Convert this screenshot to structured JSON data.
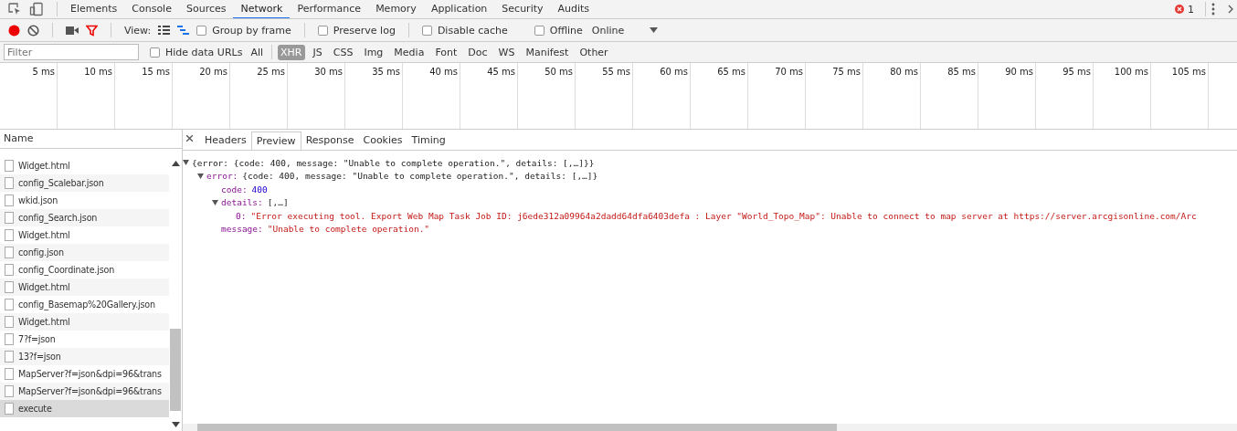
{
  "panel_tabs": [
    {
      "label": "Elements",
      "selected": false
    },
    {
      "label": "Console",
      "selected": false
    },
    {
      "label": "Sources",
      "selected": false
    },
    {
      "label": "Network",
      "selected": true
    },
    {
      "label": "Performance",
      "selected": false
    },
    {
      "label": "Memory",
      "selected": false
    },
    {
      "label": "Application",
      "selected": false
    },
    {
      "label": "Security",
      "selected": false
    },
    {
      "label": "Audits",
      "selected": false
    }
  ],
  "error_count": "1",
  "toolbar": {
    "view_label": "View:",
    "options": [
      {
        "label": "Group by frame",
        "checked": false
      },
      {
        "label": "Preserve log",
        "checked": false
      },
      {
        "label": "Disable cache",
        "checked": false
      },
      {
        "label": "Offline",
        "checked": false
      }
    ],
    "throttling": "Online"
  },
  "filter_bar": {
    "placeholder": "Filter",
    "hide_data_urls": {
      "label": "Hide data URLs",
      "checked": false
    },
    "types": [
      {
        "label": "All",
        "selected": false
      },
      {
        "label": "XHR",
        "selected": true
      },
      {
        "label": "JS",
        "selected": false
      },
      {
        "label": "CSS",
        "selected": false
      },
      {
        "label": "Img",
        "selected": false
      },
      {
        "label": "Media",
        "selected": false
      },
      {
        "label": "Font",
        "selected": false
      },
      {
        "label": "Doc",
        "selected": false
      },
      {
        "label": "WS",
        "selected": false
      },
      {
        "label": "Manifest",
        "selected": false
      },
      {
        "label": "Other",
        "selected": false
      }
    ]
  },
  "timeline_ticks": [
    "5 ms",
    "10 ms",
    "15 ms",
    "20 ms",
    "25 ms",
    "30 ms",
    "35 ms",
    "40 ms",
    "45 ms",
    "50 ms",
    "55 ms",
    "60 ms",
    "65 ms",
    "70 ms",
    "75 ms",
    "80 ms",
    "85 ms",
    "90 ms",
    "95 ms",
    "100 ms",
    "105 ms"
  ],
  "requests": {
    "column": "Name",
    "rows": [
      {
        "name": "Widget.html",
        "selected": false
      },
      {
        "name": "config_Scalebar.json",
        "selected": false
      },
      {
        "name": "wkid.json",
        "selected": false
      },
      {
        "name": "config_Search.json",
        "selected": false
      },
      {
        "name": "Widget.html",
        "selected": false
      },
      {
        "name": "config.json",
        "selected": false
      },
      {
        "name": "config_Coordinate.json",
        "selected": false
      },
      {
        "name": "Widget.html",
        "selected": false
      },
      {
        "name": "config_Basemap%20Gallery.json",
        "selected": false
      },
      {
        "name": "Widget.html",
        "selected": false
      },
      {
        "name": "7?f=json",
        "selected": false
      },
      {
        "name": "13?f=json",
        "selected": false
      },
      {
        "name": "MapServer?f=json&dpi=96&trans",
        "selected": false
      },
      {
        "name": "MapServer?f=json&dpi=96&trans",
        "selected": false
      },
      {
        "name": "execute",
        "selected": true
      }
    ]
  },
  "detail_tabs": [
    {
      "label": "Headers",
      "selected": false
    },
    {
      "label": "Preview",
      "selected": true
    },
    {
      "label": "Response",
      "selected": false
    },
    {
      "label": "Cookies",
      "selected": false
    },
    {
      "label": "Timing",
      "selected": false
    }
  ],
  "preview": [
    {
      "kind": "root",
      "text": "{error: {code: 400, message: \"Unable to complete operation.\", details: [,…]}}",
      "children": [
        {
          "kind": "object",
          "key": "error:",
          "text": "{code: 400, message: \"Unable to complete operation.\", details: [,…]}",
          "children": [
            {
              "kind": "number",
              "key": "code:",
              "text": "400"
            },
            {
              "kind": "array",
              "key": "details:",
              "text": "[,…]",
              "children": [
                {
                  "kind": "string",
                  "key": "0:",
                  "text": "\"Error executing tool. Export Web Map Task Job ID: j6ede312a09964a2dadd64dfa6403defa : Layer \"World_Topo_Map\": Unable to connect to map server at https://server.arcgisonline.com/Arc"
                }
              ]
            },
            {
              "kind": "string",
              "key": "message:",
              "text": "\"Unable to complete operation.\""
            }
          ]
        }
      ]
    }
  ]
}
